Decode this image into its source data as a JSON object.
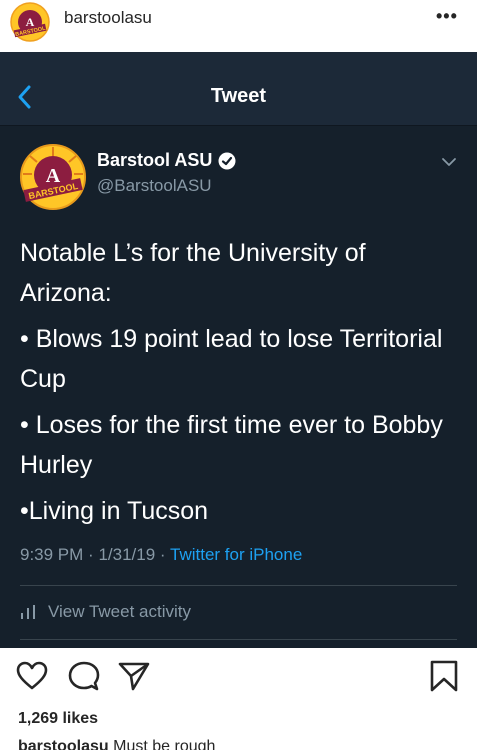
{
  "post_header": {
    "username": "barstoolasu",
    "more_label": "•••"
  },
  "tweet_screen": {
    "nav_title": "Tweet",
    "author_name": "Barstool ASU",
    "author_handle": "@BarstoolASU",
    "body": [
      "Notable L’s for the University of Arizona:",
      "• Blows 19 point lead to lose Territorial Cup",
      "• Loses for the first time ever to Bobby Hurley",
      "•Living in Tucson"
    ],
    "time": "9:39 PM",
    "date": "1/31/19",
    "separator": "·",
    "source": "Twitter for iPhone",
    "activity_label": "View Tweet activity"
  },
  "post_footer": {
    "likes": "1,269 likes",
    "caption_user": "barstoolasu",
    "caption_text": "Must be rough"
  },
  "colors": {
    "twitter_bg": "#15202b",
    "twitter_nav": "#1c2938",
    "twitter_blue": "#1da1f2",
    "twitter_gray": "#8899a6",
    "asu_maroon": "#8c1d40",
    "asu_gold": "#ffc627"
  },
  "icons": [
    "barstool-logo-icon",
    "more-icon",
    "back-chevron-icon",
    "verified-badge-icon",
    "caret-down-icon",
    "bar-chart-icon",
    "heart-icon",
    "comment-icon",
    "share-icon",
    "bookmark-icon"
  ]
}
